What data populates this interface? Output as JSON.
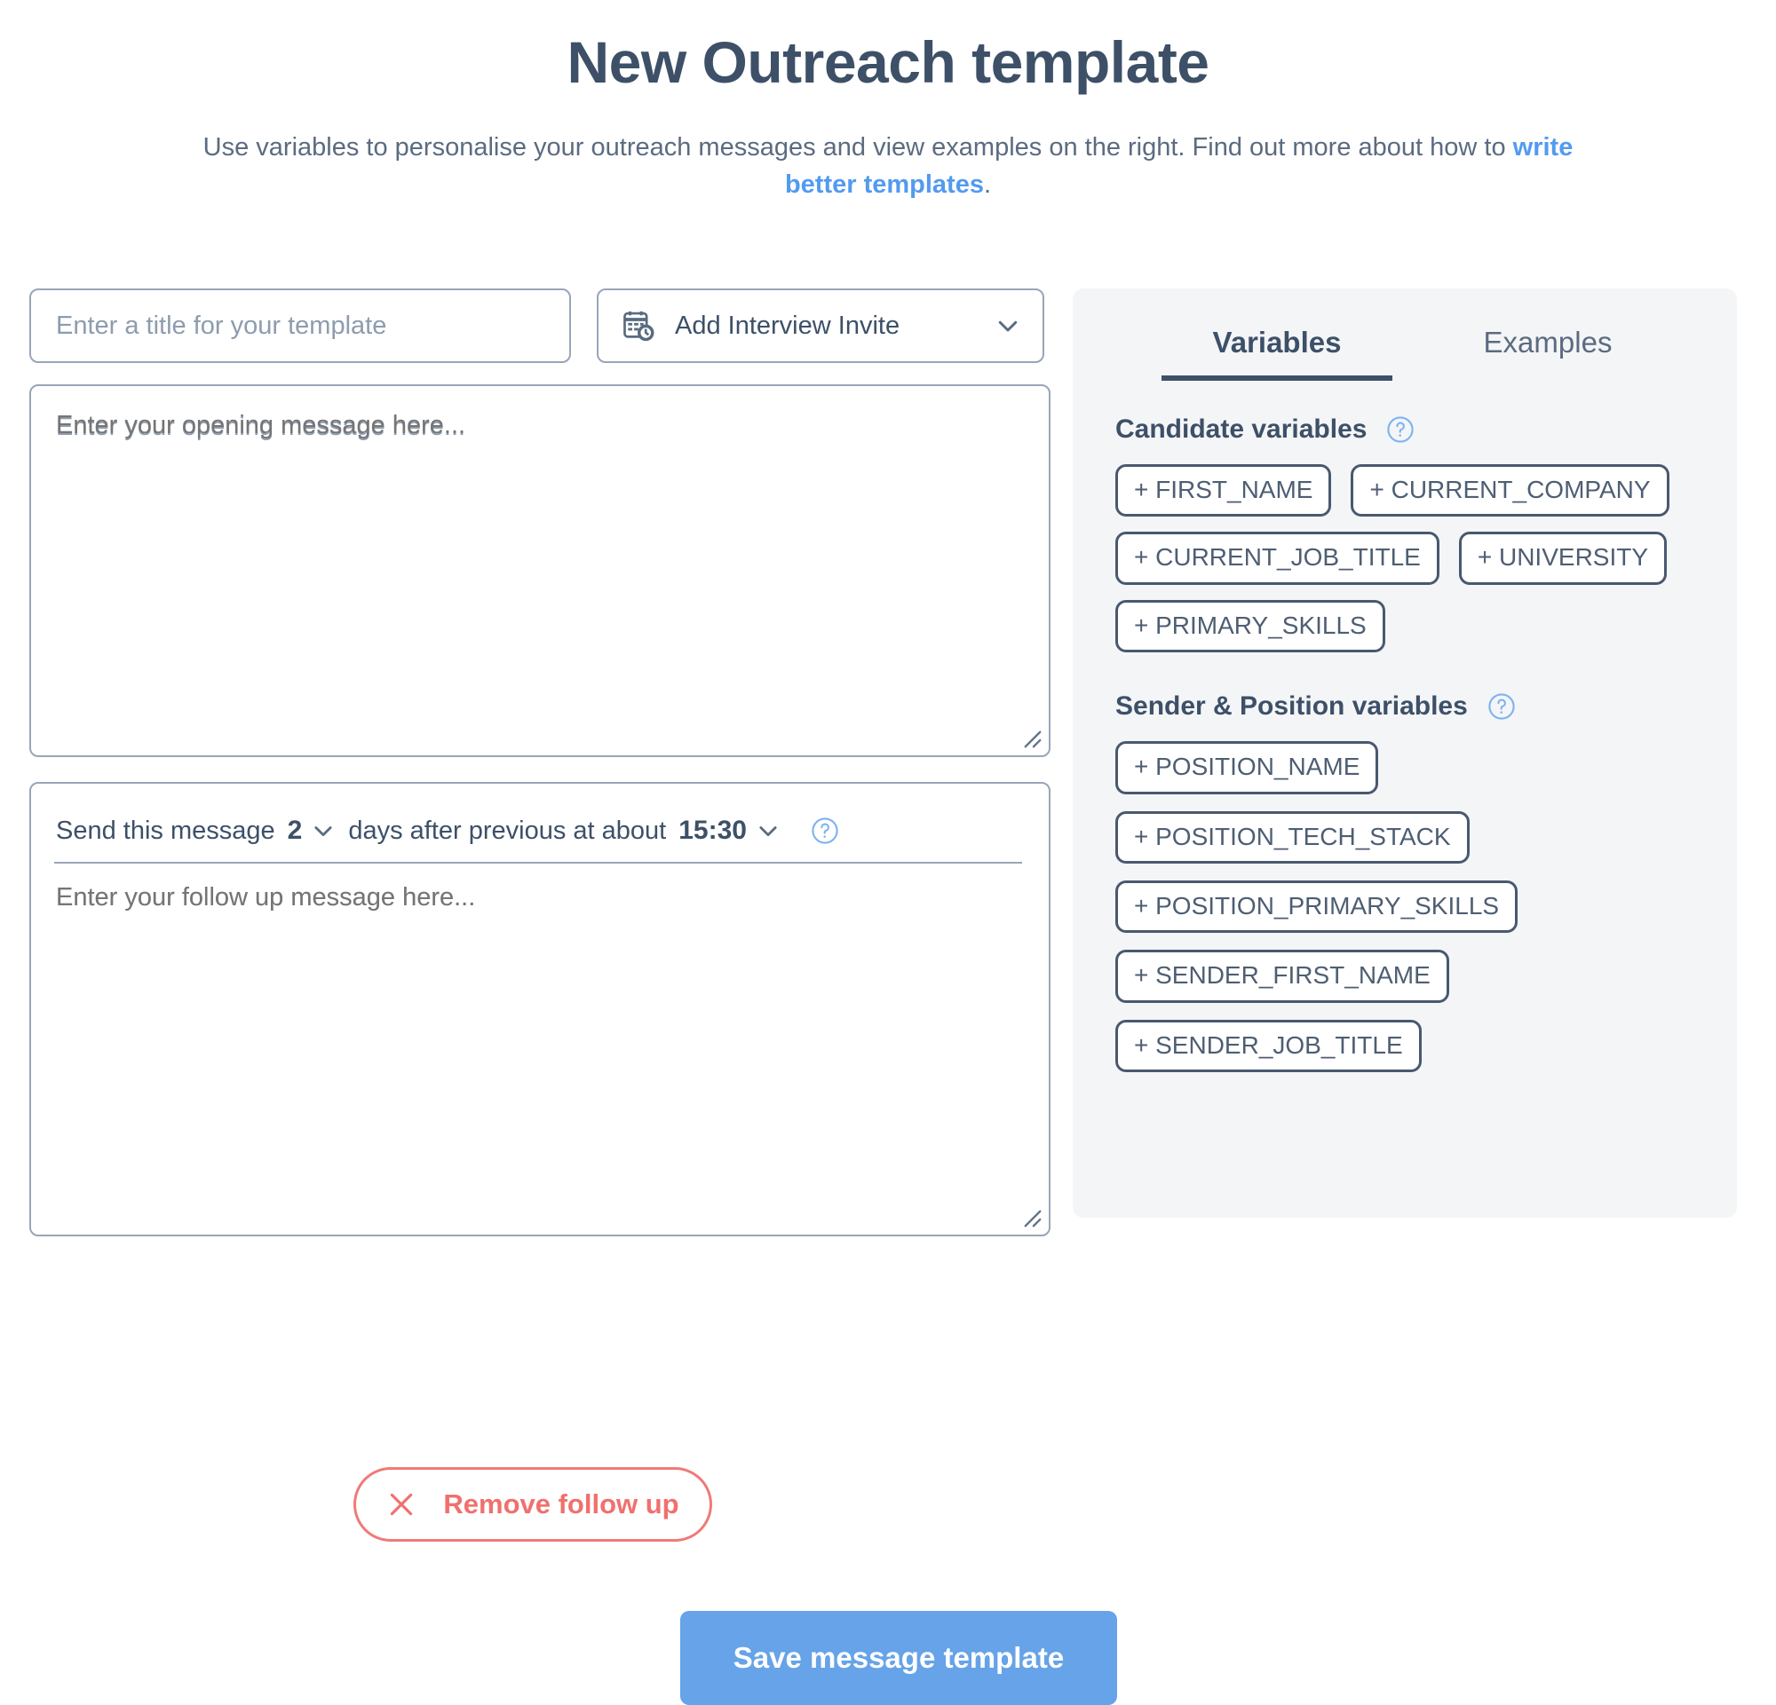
{
  "header": {
    "title": "New Outreach template",
    "subtitle_before": "Use variables to personalise your outreach messages and view examples on the right. Find out more about how to ",
    "subtitle_link": "write better templates",
    "subtitle_after": "."
  },
  "form": {
    "title_placeholder": "Enter a title for your template",
    "title_value": "",
    "interview_invite_label": "Add Interview Invite",
    "opening_placeholder": "Enter your opening message here...",
    "opening_value": "",
    "followup_placeholder": "Enter your follow up message here...",
    "followup_value": ""
  },
  "schedule": {
    "prefix": "Send this message",
    "days_value": "2",
    "middle": "days after previous at about",
    "time_value": "15:30"
  },
  "actions": {
    "remove_followup": "Remove follow up",
    "save": "Save message template"
  },
  "panel": {
    "tabs": [
      {
        "label": "Variables",
        "active": true
      },
      {
        "label": "Examples",
        "active": false
      }
    ],
    "groups": [
      {
        "heading": "Candidate variables",
        "chips": [
          "+ FIRST_NAME",
          "+ CURRENT_COMPANY",
          "+ CURRENT_JOB_TITLE",
          "+ UNIVERSITY",
          "+ PRIMARY_SKILLS"
        ]
      },
      {
        "heading": "Sender & Position variables",
        "chips": [
          "+ POSITION_NAME",
          "+ POSITION_TECH_STACK",
          "+ POSITION_PRIMARY_SKILLS",
          "+ SENDER_FIRST_NAME",
          "+ SENDER_JOB_TITLE"
        ]
      }
    ]
  },
  "colors": {
    "text_dark": "#3d5068",
    "link_blue": "#539af0",
    "primary_blue": "#66a3e8",
    "danger_red": "#f0706e",
    "panel_bg": "#f4f5f7",
    "border_grey": "#98a6b8"
  }
}
